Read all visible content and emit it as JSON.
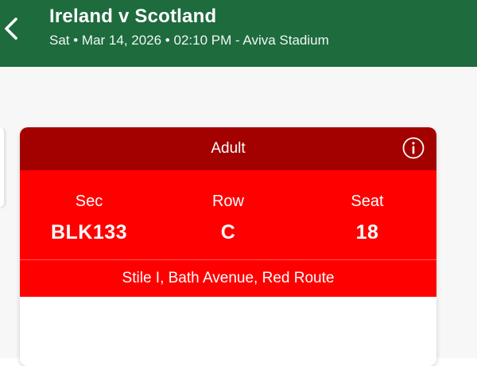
{
  "header": {
    "title": "Ireland v Scotland",
    "subtitle": "Sat • Mar 14, 2026 • 02:10 PM - Aviva Stadium",
    "back_icon": "chevron-left-icon",
    "background_color": "#1e6b3e"
  },
  "ticket": {
    "type": "Adult",
    "info_icon": "info-icon",
    "header_color": "#a30000",
    "band_color": "#ff0000",
    "section": {
      "label": "Sec",
      "value": "BLK133"
    },
    "row": {
      "label": "Row",
      "value": "C"
    },
    "seat": {
      "label": "Seat",
      "value": "18"
    },
    "entrance": "Stile I, Bath Avenue, Red Route"
  }
}
